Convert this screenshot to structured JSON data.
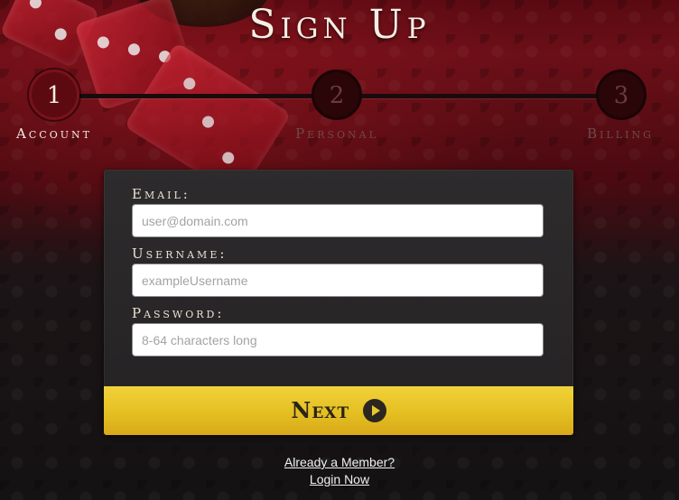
{
  "page": {
    "title": "Sign Up"
  },
  "steps": [
    {
      "number": "1",
      "label": "Account",
      "active": true
    },
    {
      "number": "2",
      "label": "Personal",
      "active": false
    },
    {
      "number": "3",
      "label": "Billing",
      "active": false
    }
  ],
  "form": {
    "email": {
      "label": "Email:",
      "placeholder": "user@domain.com",
      "value": ""
    },
    "username": {
      "label": "Username:",
      "placeholder": "exampleUsername",
      "value": ""
    },
    "password": {
      "label": "Password:",
      "placeholder": "8-64 characters long",
      "value": ""
    },
    "next_label": "Next",
    "next_icon": "play-circle-icon"
  },
  "footer": {
    "member_link": "Already a Member?",
    "login_link": "Login Now"
  },
  "colors": {
    "accent": "#e4bf22",
    "background_top": "#6b0f18",
    "background_bottom": "#141213",
    "panel": "#2a2829",
    "active_step": "#5c0a10"
  }
}
